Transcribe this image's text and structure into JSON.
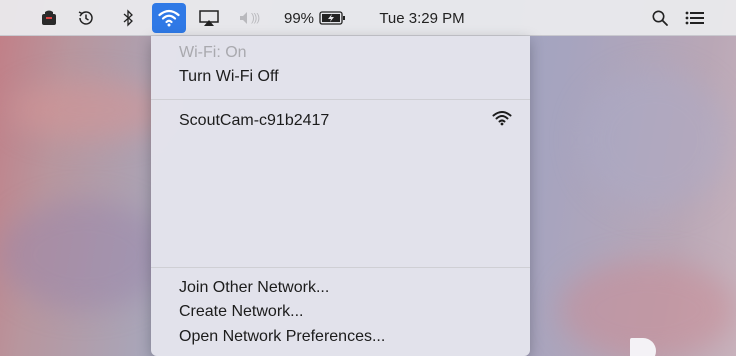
{
  "menubar": {
    "icons": [
      "app-icon",
      "time-machine-icon",
      "bluetooth-icon",
      "wifi-icon",
      "airplay-icon",
      "volume-icon",
      "battery-charging-icon",
      "search-icon",
      "notification-center-icon"
    ],
    "battery_percent": "99%",
    "clock": "Tue 3:29 PM",
    "wifi_highlight_color": "#2f79e6"
  },
  "wifi_menu": {
    "status": "Wi-Fi: On",
    "toggle": "Turn Wi-Fi Off",
    "networks": [
      {
        "name": "ScoutCam-c91b2417",
        "signal_icon": "wifi-signal-icon"
      }
    ],
    "join_other": "Join Other Network...",
    "create": "Create Network...",
    "preferences": "Open Network Preferences..."
  }
}
